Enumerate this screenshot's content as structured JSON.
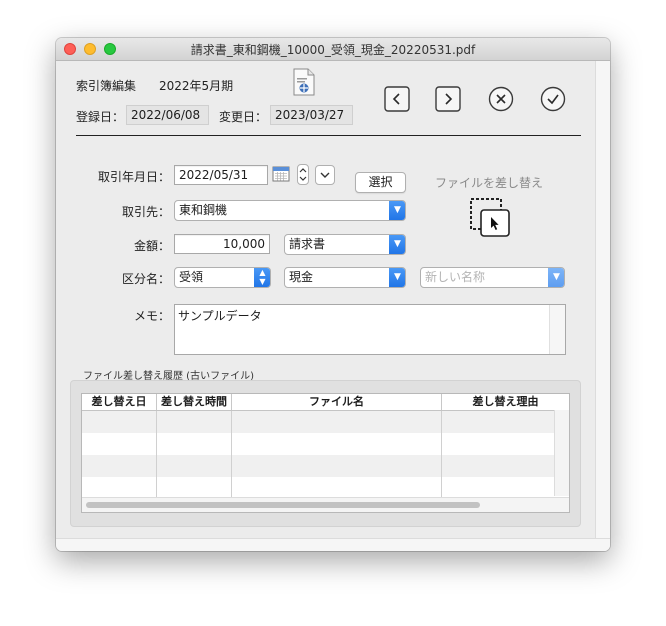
{
  "window": {
    "title": "請求書_東和鋼機_10000_受領_現金_20220531.pdf"
  },
  "header": {
    "app_name": "索引簿編集",
    "period": "2022年5月期",
    "registered_label": "登録日：",
    "registered_date": "2022/06/08",
    "modified_label": "変更日：",
    "modified_date": "2023/03/27"
  },
  "nav": {
    "prev": "chevron-left-icon",
    "next": "chevron-right-icon",
    "cancel": "x-circle-icon",
    "ok": "check-circle-icon"
  },
  "form": {
    "date_label": "取引年月日：",
    "date_value": "2022/05/31",
    "select_button": "選択",
    "replace_file_label": "ファイルを差し替え",
    "partner_label": "取引先：",
    "partner_value": "東和鋼機",
    "amount_label": "金額：",
    "amount_value": "10,000",
    "doc_type_value": "請求書",
    "category_label": "区分名：",
    "category_value": "受領",
    "payment_value": "現金",
    "new_name_placeholder": "新しい名称",
    "memo_label": "メモ：",
    "memo_value": "サンプルデータ"
  },
  "history": {
    "title": "ファイル差し替え履歴 (古いファイル)",
    "columns": [
      "差し替え日",
      "差し替え時間",
      "ファイル名",
      "差し替え理由"
    ],
    "rows": [
      [
        "",
        "",
        "",
        ""
      ],
      [
        "",
        "",
        "",
        ""
      ],
      [
        "",
        "",
        "",
        ""
      ],
      [
        "",
        "",
        "",
        ""
      ]
    ]
  },
  "colors": {
    "accent": "#1f73e6",
    "close": "#fe5f57",
    "minimize": "#febc2e",
    "maximize": "#28c840"
  }
}
